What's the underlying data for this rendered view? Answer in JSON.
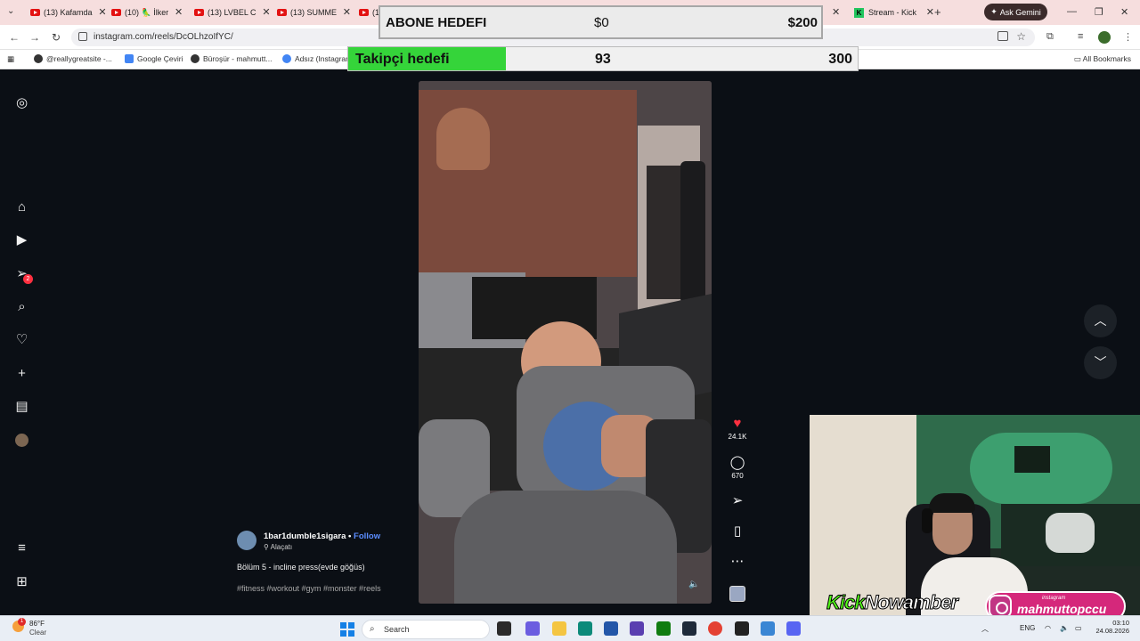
{
  "browser": {
    "tabs": [
      {
        "title": "(13) Kafamda",
        "icon": "youtube-icon"
      },
      {
        "title": "(10) 🦜 İlker",
        "icon": "youtube-icon"
      },
      {
        "title": "(13) LVBEL C",
        "icon": "youtube-icon"
      },
      {
        "title": "(13) SUMME",
        "icon": "youtube-icon"
      },
      {
        "title": "(1",
        "icon": "youtube-icon"
      },
      {
        "title": "Stream - Kick",
        "icon": "kick-icon"
      }
    ],
    "gemini_label": "Ask Gemini",
    "url": "instagram.com/reels/DcOLhzoIfYC/",
    "bookmarks": [
      "@reallygreatsite -...",
      "Google Çeviri",
      "Büroşür - mahmutt...",
      "Adsız (Instagram"
    ],
    "all_bookmarks": "All Bookmarks"
  },
  "overlay": {
    "sub_goal": {
      "label": "ABONE HEDEFI",
      "current": "$0",
      "target": "$200"
    },
    "follower_goal": {
      "label": "Takipçi hedefi",
      "current": "93",
      "target": "300",
      "progress": 0.31
    },
    "kick_banner": {
      "part1": "Kick",
      "part2": "Nowamber"
    },
    "instagram_banner": {
      "small": "instagram",
      "handle": "mahmuttopccu"
    }
  },
  "reel": {
    "username": "1bar1dumble1sigara",
    "separator": " • ",
    "follow_label": "Follow",
    "location": "Alaçatı",
    "caption": "Bölüm 5 - incline press(evde göğüs)",
    "hashtags": "#fitness #workout #gym #monster #reels",
    "likes": "24.1K",
    "comments": "670"
  },
  "sidebar": {
    "items": [
      "instagram-logo-icon",
      "home-icon",
      "reels-icon",
      "messages-icon",
      "search-icon",
      "notifications-icon",
      "create-icon",
      "dashboard-icon",
      "profile-avatar",
      "menu-icon",
      "also-from-meta-icon"
    ],
    "messages_badge": "2"
  },
  "taskbar": {
    "temperature": "86°F",
    "weather": "Clear",
    "weather_badge": "1",
    "search_placeholder": "Search",
    "language": "ENG",
    "time": "03:10",
    "date": "24.08.2026"
  },
  "colors": {
    "progress_fill": "#35d43a",
    "like_heart": "#ff3040",
    "follow_link": "#5b8dff",
    "kick_green": "#53fc18"
  }
}
